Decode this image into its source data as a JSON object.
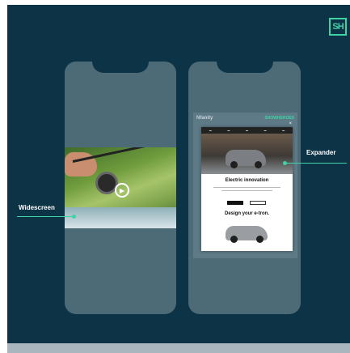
{
  "brand": {
    "logo_text": "SH",
    "accent": "#3fd3a6"
  },
  "background": "#0d3346",
  "phones": {
    "left": {
      "format_label": "Widescreen",
      "media": {
        "icon": "play-icon"
      }
    },
    "right": {
      "format_label": "Expander",
      "site": {
        "logo_text": "Nfanity",
        "brand_text": "SHOWHEROES"
      },
      "ad": {
        "close_glyph": "×",
        "headline": "Electric innovation",
        "primary_button": "",
        "secondary_button": "",
        "second_headline": "Design your e-tron."
      }
    }
  }
}
